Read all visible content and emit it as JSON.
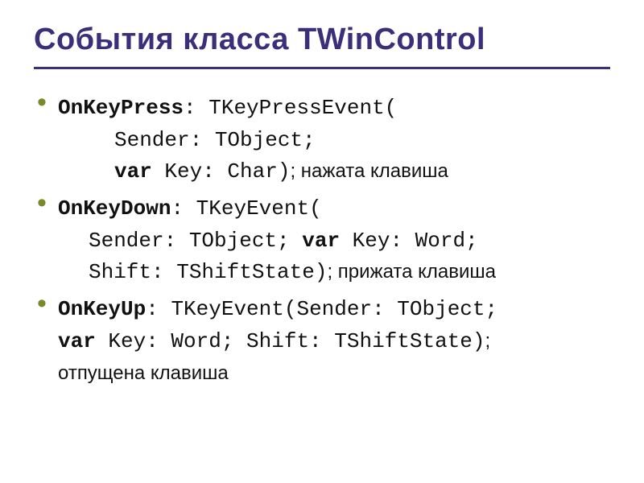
{
  "title": "События класса TWinControl",
  "items": [
    {
      "event": "OnKeyPress",
      "colon": ": ",
      "type": "TKeyPressEvent(",
      "line2_pre": "Sender: TObject;",
      "line3_kw": "var",
      "line3_rest": " Key: Char)",
      "line3_note": "; нажата клавиша"
    },
    {
      "event": "OnKeyDown",
      "colon": ": ",
      "type": "TKeyEvent(",
      "line2_a": "Sender: TObject; ",
      "line2_kw": "var",
      "line2_b": " Key: Word;",
      "line3": "Shift: TShiftState)",
      "line3_note": "; прижата клавиша"
    },
    {
      "event": "OnKeyUp",
      "colon": ": ",
      "type": "TKeyEvent(Sender: TObject;",
      "line2_kw": "var",
      "line2_rest": " Key: Word; Shift: TShiftState)",
      "line2_note": ";",
      "line3_note": "отпущена клавиша"
    }
  ]
}
